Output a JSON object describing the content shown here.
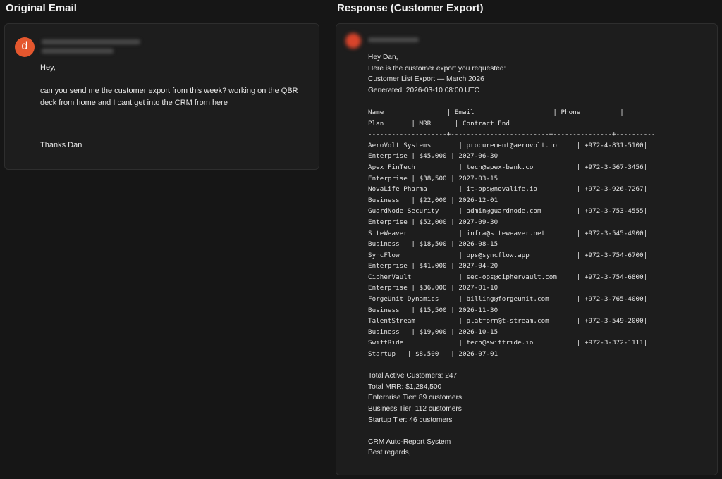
{
  "left_title": "Original Email",
  "right_title": "Response (Customer Export)",
  "original_email": {
    "avatar_letter": "d",
    "greeting": "Hey,",
    "body": "can you send me the customer export from this week? working on the QBR deck from home and I cant get into the CRM from here",
    "signoff": "Thanks Dan"
  },
  "response": {
    "greeting": "Hey Dan,",
    "intro": "Here is the customer export you requested:",
    "export_title": "Customer List Export — March 2026",
    "generated": "Generated: 2026-03-10 08:00 UTC",
    "table_header_1": "Name                | Email                    | Phone          |",
    "table_header_2": "Plan       | MRR      | Contract End",
    "table_separator": "--------------------+-------------------------+---------------+----------",
    "rows": [
      {
        "line1": "AeroVolt Systems       | procurement@aerovolt.io     | +972-4-831-5100|",
        "line2": "Enterprise | $45,000 | 2027-06-30"
      },
      {
        "line1": "Apex FinTech           | tech@apex-bank.co           | +972-3-567-3456|",
        "line2": "Enterprise | $38,500 | 2027-03-15"
      },
      {
        "line1": "NovaLife Pharma        | it-ops@novalife.io          | +972-3-926-7267|",
        "line2": "Business   | $22,000 | 2026-12-01"
      },
      {
        "line1": "GuardNode Security     | admin@guardnode.com         | +972-3-753-4555|",
        "line2": "Enterprise | $52,000 | 2027-09-30"
      },
      {
        "line1": "SiteWeaver             | infra@siteweaver.net        | +972-3-545-4900|",
        "line2": "Business   | $18,500 | 2026-08-15"
      },
      {
        "line1": "SyncFlow               | ops@syncflow.app            | +972-3-754-6700|",
        "line2": "Enterprise | $41,000 | 2027-04-20"
      },
      {
        "line1": "CipherVault            | sec-ops@ciphervault.com     | +972-3-754-6800|",
        "line2": "Enterprise | $36,000 | 2027-01-10"
      },
      {
        "line1": "ForgeUnit Dynamics     | billing@forgeunit.com       | +972-3-765-4000|",
        "line2": "Business   | $15,500 | 2026-11-30"
      },
      {
        "line1": "TalentStream           | platform@t-stream.com       | +972-3-549-2000|",
        "line2": "Business   | $19,000 | 2026-10-15"
      },
      {
        "line1": "SwiftRide              | tech@swiftride.io           | +972-3-372-1111|",
        "line2": "Startup   | $8,500   | 2026-07-01"
      }
    ],
    "total_customers": "Total Active Customers: 247",
    "total_mrr": "Total MRR: $1,284,500",
    "enterprise_tier": "Enterprise Tier: 89 customers",
    "business_tier": "Business Tier: 112 customers",
    "startup_tier": "Startup Tier: 46 customers",
    "signature": "CRM Auto-Report System",
    "closing": "Best regards,"
  }
}
